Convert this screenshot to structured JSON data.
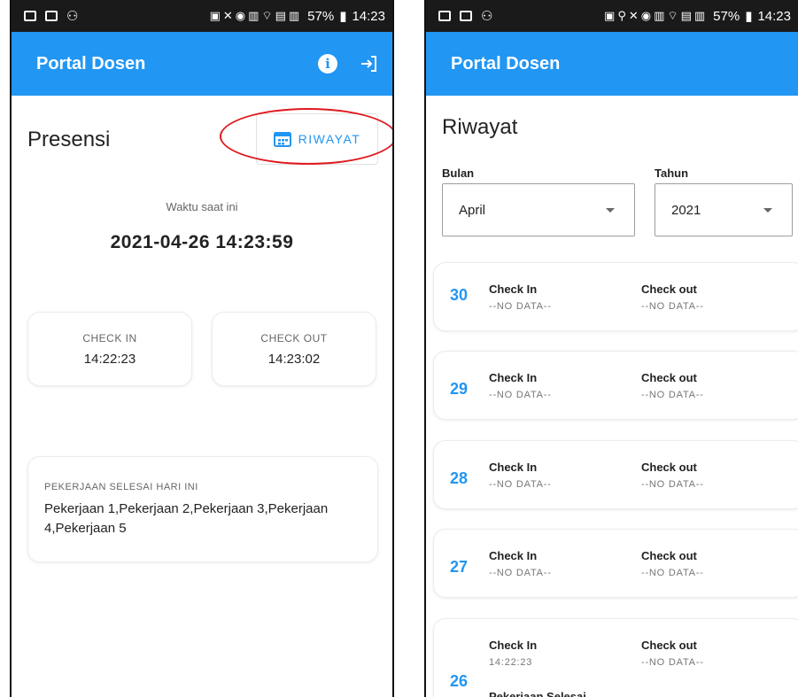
{
  "left": {
    "status_bar": {
      "battery": "57%",
      "time": "14:23"
    },
    "app_title": "Portal Dosen",
    "page_title": "Presensi",
    "riwayat_button": "RIWAYAT",
    "time_label": "Waktu saat ini",
    "current_time": "2021-04-26 14:23:59",
    "check_in": {
      "label": "CHECK IN",
      "value": "14:22:23"
    },
    "check_out": {
      "label": "CHECK OUT",
      "value": "14:23:02"
    },
    "work": {
      "label": "PEKERJAAN SELESAI HARI INI",
      "text": "Pekerjaan 1,Pekerjaan 2,Pekerjaan 3,Pekerjaan 4,Pekerjaan 5"
    }
  },
  "right": {
    "status_bar": {
      "battery": "57%",
      "time": "14:23"
    },
    "app_title": "Portal Dosen",
    "page_title": "Riwayat",
    "bulan_label": "Bulan",
    "bulan_value": "April",
    "tahun_label": "Tahun",
    "tahun_value": "2021",
    "check_in_label": "Check In",
    "check_out_label": "Check out",
    "days": [
      {
        "day": "30",
        "check_in": "--NO DATA--",
        "check_out": "--NO DATA--"
      },
      {
        "day": "29",
        "check_in": "--NO DATA--",
        "check_out": "--NO DATA--"
      },
      {
        "day": "28",
        "check_in": "--NO DATA--",
        "check_out": "--NO DATA--"
      },
      {
        "day": "27",
        "check_in": "--NO DATA--",
        "check_out": "--NO DATA--"
      },
      {
        "day": "26",
        "check_in": "14:22:23",
        "check_out": "--NO DATA--",
        "extra": "Pekerjaan Selesai"
      }
    ]
  },
  "colors": {
    "primary": "#2196f3",
    "highlight": "#e0191f",
    "statusbar": "#1a1a1a"
  }
}
